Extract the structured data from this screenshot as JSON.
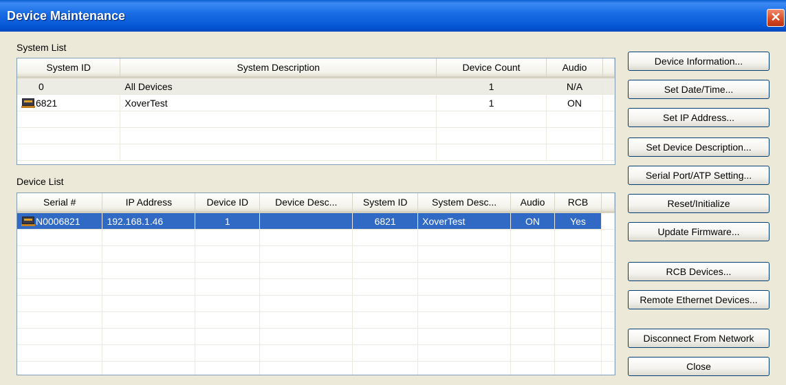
{
  "window": {
    "title": "Device Maintenance",
    "close_glyph": "✕"
  },
  "system_list": {
    "label": "System List",
    "columns": [
      "System ID",
      "System Description",
      "Device Count",
      "Audio"
    ],
    "rows": [
      {
        "id": "0",
        "description": "All Devices",
        "count": "1",
        "audio": "N/A",
        "icon": ""
      },
      {
        "id": "6821",
        "description": "XoverTest",
        "count": "1",
        "audio": "ON",
        "icon": "network-device-icon"
      }
    ]
  },
  "device_list": {
    "label": "Device List",
    "columns": [
      "Serial #",
      "IP Address",
      "Device ID",
      "Device Desc...",
      "System ID",
      "System Desc...",
      "Audio",
      "RCB"
    ],
    "rows": [
      {
        "serial": "N0006821",
        "ip": "192.168.1.46",
        "device_id": "1",
        "device_desc": "",
        "system_id": "6821",
        "system_desc": "XoverTest",
        "audio": "ON",
        "rcb": "Yes",
        "icon": "network-device-icon"
      }
    ]
  },
  "buttons": {
    "device_information": "Device Information...",
    "set_date_time": "Set Date/Time...",
    "set_ip_address": "Set IP Address...",
    "set_device_description": "Set Device Description...",
    "serial_port_atp": "Serial Port/ATP Setting...",
    "reset_initialize": "Reset/Initialize",
    "update_firmware": "Update Firmware...",
    "rcb_devices": "RCB Devices...",
    "remote_ethernet_devices": "Remote Ethernet Devices...",
    "disconnect": "Disconnect From Network",
    "close": "Close"
  },
  "colors": {
    "selection": "#316ac5",
    "titlebar": "#0658d6",
    "dialog_bg": "#ece9d8"
  }
}
